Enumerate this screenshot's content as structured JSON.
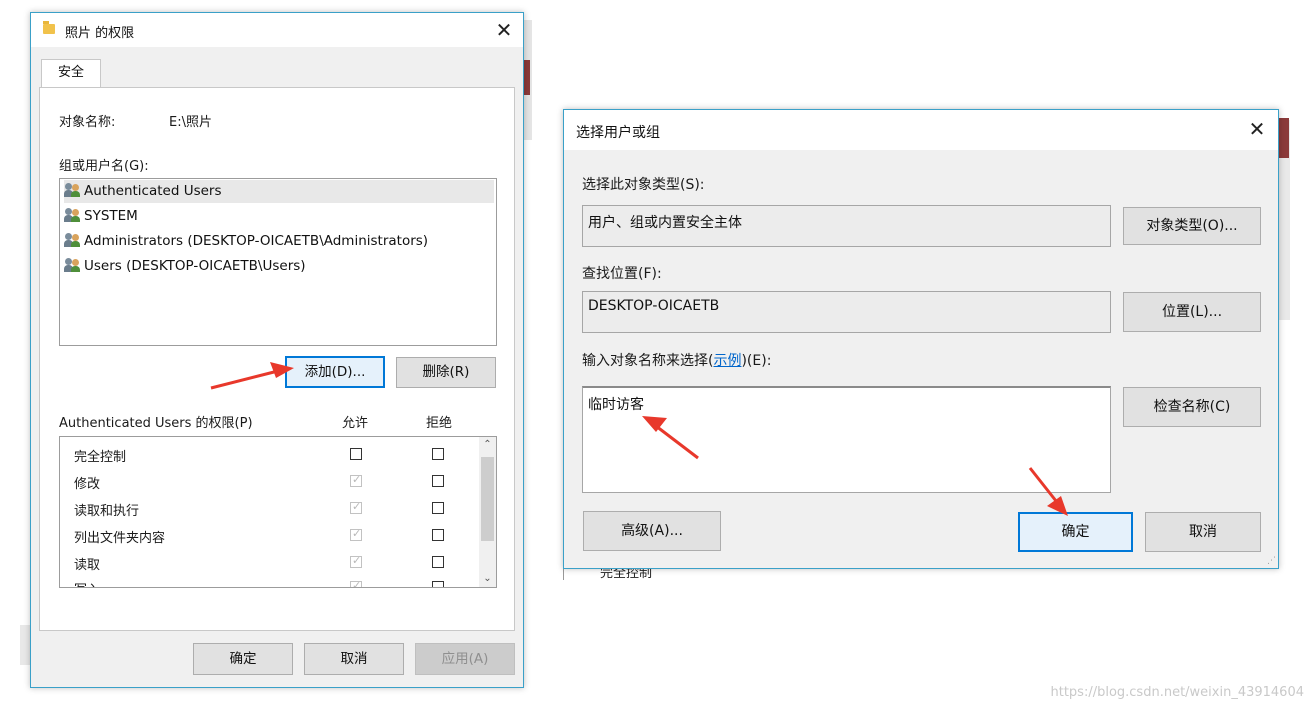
{
  "perm_dialog": {
    "title": "照片 的权限",
    "close": "✕",
    "tab": "安全",
    "object_label": "对象名称:",
    "object_value": "E:\\照片",
    "group_label": "组或用户名(G):",
    "users": [
      "Authenticated Users",
      "SYSTEM",
      "Administrators (DESKTOP-OICAETB\\Administrators)",
      "Users (DESKTOP-OICAETB\\Users)"
    ],
    "add_button": "添加(D)...",
    "remove_button": "删除(R)",
    "perm_header": "Authenticated Users 的权限(P)",
    "allow_header": "允许",
    "deny_header": "拒绝",
    "permissions": [
      {
        "name": "完全控制",
        "allow": false,
        "deny": false
      },
      {
        "name": "修改",
        "allow": true,
        "deny": false
      },
      {
        "name": "读取和执行",
        "allow": true,
        "deny": false
      },
      {
        "name": "列出文件夹内容",
        "allow": true,
        "deny": false
      },
      {
        "name": "读取",
        "allow": true,
        "deny": false
      },
      {
        "name": "写入",
        "allow": true,
        "deny": false
      }
    ],
    "ok_button": "确定",
    "cancel_button": "取消",
    "apply_button": "应用(A)"
  },
  "select_dialog": {
    "title": "选择用户或组",
    "close": "✕",
    "type_label": "选择此对象类型(S):",
    "type_value": "用户、组或内置安全主体",
    "type_button": "对象类型(O)...",
    "location_label": "查找位置(F):",
    "location_value": "DESKTOP-OICAETB",
    "location_button": "位置(L)...",
    "name_label_prefix": "输入对象名称来选择(",
    "name_label_link": "示例",
    "name_label_suffix": ")(E):",
    "name_value": "临时访客",
    "check_button": "检查名称(C)",
    "advanced_button": "高级(A)...",
    "ok_button": "确定",
    "cancel_button": "取消"
  },
  "behind_text": "完全控制",
  "watermark": "https://blog.csdn.net/weixin_43914604",
  "colors": {
    "accent": "#0078d7",
    "arrow": "#e8382b",
    "window_border": "#3aa0c8"
  }
}
